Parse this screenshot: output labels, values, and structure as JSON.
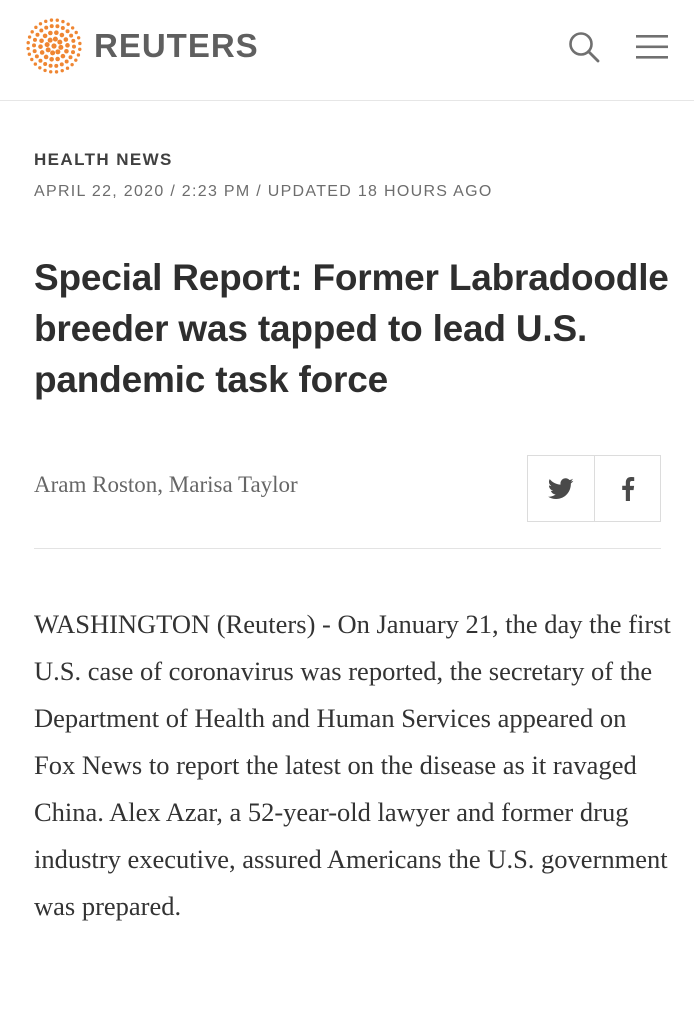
{
  "header": {
    "brand": "REUTERS",
    "brand_color": "#ef8632",
    "search_icon": "search-icon",
    "menu_icon": "hamburger-menu-icon"
  },
  "article": {
    "section": "HEALTH NEWS",
    "dateline": "APRIL 22, 2020 / 2:23 PM / UPDATED 18 HOURS AGO",
    "title": "Special Report: Former Labradoodle breeder was tapped to lead U.S. pandemic task force",
    "authors": "Aram Roston, Marisa Taylor",
    "share": [
      "twitter-icon",
      "facebook-icon"
    ],
    "body": "WASHINGTON (Reuters) - On January 21, the day the first U.S. case of coronavirus was reported, the secretary of the Department of Health and Human Services appeared on Fox News to report the latest on the disease as it ravaged China. Alex Azar, a 52-year-old lawyer and former drug industry executive, assured Americans the U.S. government was prepared."
  }
}
